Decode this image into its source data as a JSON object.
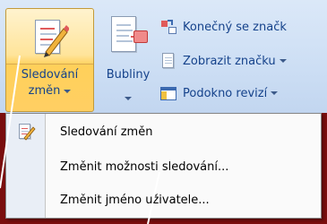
{
  "ribbon": {
    "track_changes": {
      "label_line1": "Sledování",
      "label_line2": "změn"
    },
    "balloons": {
      "label": "Bubliny"
    },
    "items": [
      {
        "label": "Konečný se značk",
        "icon": "final-markup-icon"
      },
      {
        "label": "Zobrazit značku",
        "icon": "show-markup-icon"
      },
      {
        "label": "Podokno revizí",
        "icon": "reviewing-pane-icon"
      }
    ]
  },
  "menu": {
    "items": [
      {
        "label": "Sledování změn",
        "icon": "track-changes-icon"
      },
      {
        "label": "Změnit možnosti sledování...",
        "icon": ""
      },
      {
        "label": "Změnit jméno uživatele...",
        "icon": ""
      }
    ]
  },
  "colors": {
    "background": "#7a0e0e",
    "annotation": "#ffffff",
    "highlight": "#ffd05a"
  }
}
